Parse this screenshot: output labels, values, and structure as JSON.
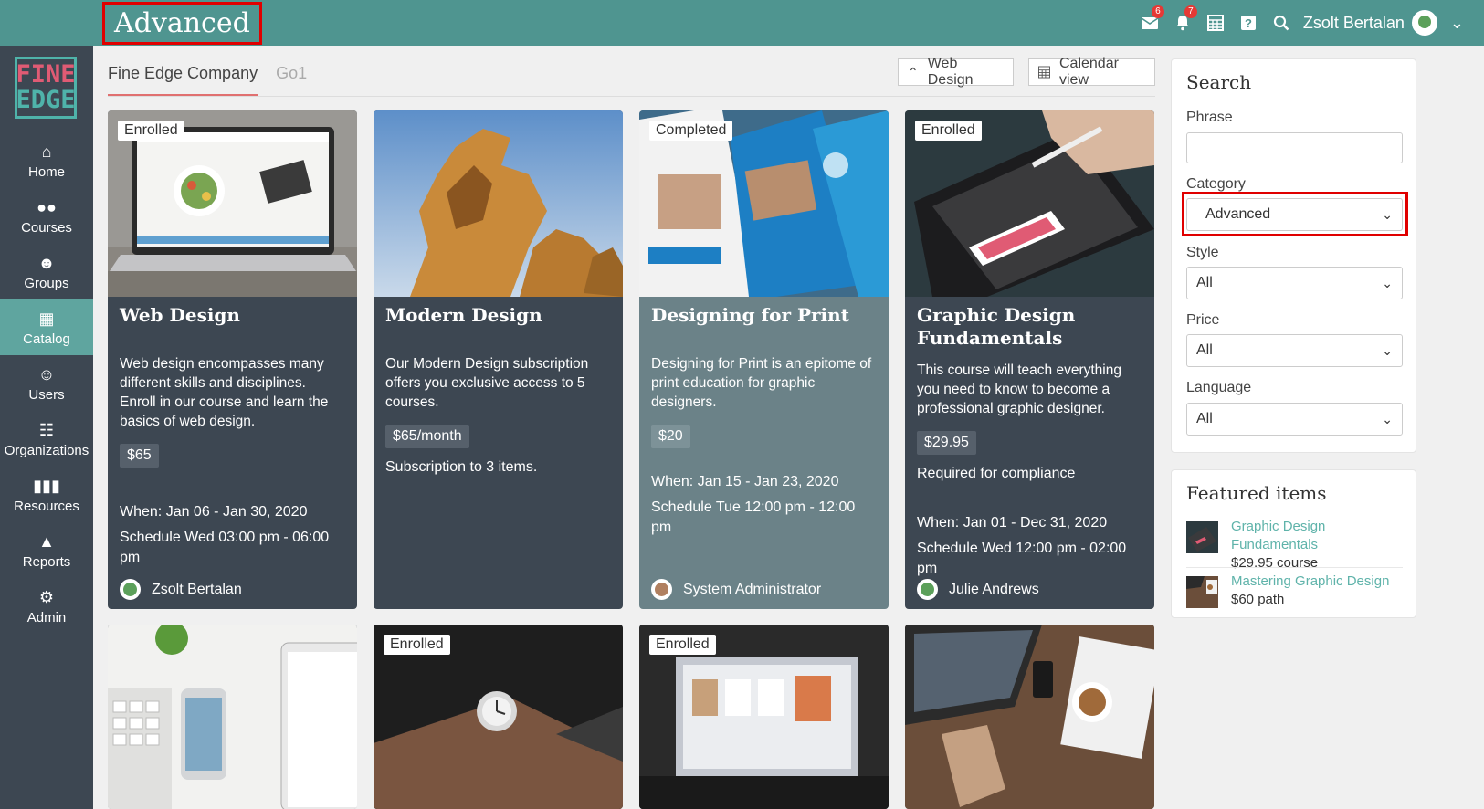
{
  "header": {
    "title": "Advanced",
    "messages_badge": "6",
    "notifications_badge": "7",
    "user_name": "Zsolt Bertalan"
  },
  "logo": {
    "line1": "FINE",
    "line2": "EDGE"
  },
  "sidebar": {
    "items": [
      {
        "label": "Home",
        "icon": "home-icon"
      },
      {
        "label": "Courses",
        "icon": "courses-icon"
      },
      {
        "label": "Groups",
        "icon": "groups-icon"
      },
      {
        "label": "Catalog",
        "icon": "catalog-icon",
        "active": true
      },
      {
        "label": "Users",
        "icon": "user-icon"
      },
      {
        "label": "Organizations",
        "icon": "organizations-icon"
      },
      {
        "label": "Resources",
        "icon": "resources-icon"
      },
      {
        "label": "Reports",
        "icon": "reports-icon"
      },
      {
        "label": "Admin",
        "icon": "gear-icon"
      }
    ]
  },
  "tabs": [
    {
      "label": "Fine Edge Company",
      "active": true
    },
    {
      "label": "Go1",
      "active": false
    }
  ],
  "toolbar": {
    "filter_label": "Web Design",
    "calendar_label": "Calendar view"
  },
  "cards": [
    {
      "tag": "Enrolled",
      "title": "Web Design",
      "description": "Web design encompasses many different skills and disciplines. Enroll in our course and learn the basics of web design.",
      "price": "$65",
      "when": "When: Jan 06 - Jan 30, 2020",
      "schedule": "Schedule Wed 03:00 pm - 06:00 pm",
      "author": "Zsolt Bertalan"
    },
    {
      "tag": "",
      "title": "Modern Design",
      "description": "Our Modern Design subscription offers you exclusive access to 5 courses.",
      "price": "$65/month",
      "note": "Subscription to 3 items."
    },
    {
      "tag": "Completed",
      "title": "Designing for Print",
      "description": "Designing for Print is an epitome of print education for graphic designers.",
      "price": "$20",
      "when": "When: Jan 15 - Jan 23, 2020",
      "schedule": "Schedule Tue 12:00 pm - 12:00 pm",
      "author": "System Administrator"
    },
    {
      "tag": "Enrolled",
      "title": "Graphic Design Fundamentals",
      "description": "This course will teach everything you need to know to become a professional graphic designer.",
      "price": "$29.95",
      "note": "Required for compliance",
      "when": "When: Jan 01 - Dec 31, 2020",
      "schedule": "Schedule Wed 12:00 pm - 02:00 pm",
      "author": "Julie Andrews"
    }
  ],
  "bottom_cards": [
    {
      "tag": ""
    },
    {
      "tag": "Enrolled"
    },
    {
      "tag": "Enrolled"
    },
    {
      "tag": ""
    }
  ],
  "search": {
    "title": "Search",
    "phrase_label": "Phrase",
    "phrase_value": "",
    "category_label": "Category",
    "category_value": "Advanced",
    "style_label": "Style",
    "style_value": "All",
    "price_label": "Price",
    "price_value": "All",
    "language_label": "Language",
    "language_value": "All"
  },
  "featured": {
    "title": "Featured items",
    "items": [
      {
        "name": "Graphic Design Fundamentals",
        "sub": "$29.95 course"
      },
      {
        "name": "Mastering Graphic Design",
        "sub": "$60 path"
      }
    ]
  },
  "colors": {
    "topbar": "#4f9590",
    "sidebar": "#3d4752",
    "accent": "#5fb3aa",
    "highlight": "#e00000"
  }
}
